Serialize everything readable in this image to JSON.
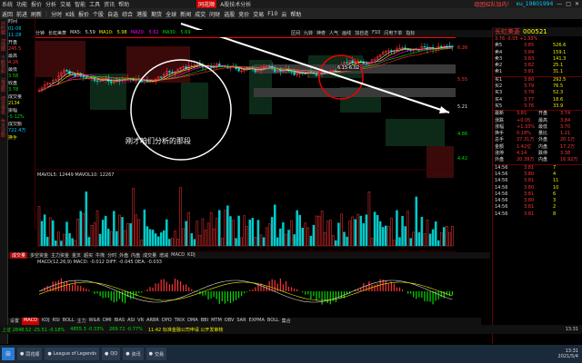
{
  "titlebar": {
    "menus": [
      "系统",
      "功能",
      "报价",
      "分析",
      "交易",
      "智能",
      "工具",
      "资讯",
      "帮助"
    ],
    "logo": "同花顺",
    "mode": "A股技术分析",
    "promo": "组团招队加内！",
    "user": "xu_19801994"
  },
  "toolbar": {
    "items": [
      "返回",
      "前进",
      "刷新",
      "分时",
      "K线",
      "报价",
      "个股",
      "自选",
      "综合",
      "港股",
      "期货",
      "全球",
      "新闻",
      "成交",
      "问财",
      "选股",
      "竞价",
      "交易",
      "F10",
      "云",
      "帮助"
    ]
  },
  "leftstrip": [
    "分时图",
    "K线图",
    "个股资料",
    "自选股",
    "综合排名",
    "牛叉诊股"
  ],
  "infopanel": [
    "时间",
    "01-06",
    "11:28",
    "开盘",
    "245.5",
    "最高",
    "4.26",
    "最低",
    "3.58",
    "收盘",
    "3.78",
    "成交量",
    "2134",
    "振幅",
    "-5.12%",
    "成交额",
    "722.4万",
    "换手",
    "1.00"
  ],
  "chartbar": [
    "分钟",
    "长虹美菱",
    "MA5:",
    "5.59",
    "MA10:",
    "5.98",
    "MA20:",
    "5.62",
    "MA30:",
    "5.69"
  ],
  "charttoolbar": [
    "区间",
    "九转",
    "神奇",
    "人气",
    "画线",
    "加自选",
    "F10",
    "闪电下单",
    "指标"
  ],
  "annotation": "刚才咱们分析的那段",
  "pricelabels": [
    "6.26",
    "5.55",
    "5.21",
    "4.86",
    "4.42"
  ],
  "callout": "6.15-6.02",
  "vol_label": "MAVOL5: 12449  MAVOL10: 12267",
  "macd_label": "MACD(12,26,9)  MACD: -0.012  DIFF: -0.045  DEA: -0.033",
  "indicator_tabs": [
    "成交量",
    "多空资金",
    "主力资金",
    "金叉",
    "超买",
    "牛熊",
    "分时",
    "外盘",
    "内盘",
    "成交量",
    "增减",
    "MACD",
    "KDJ"
  ],
  "bottomtabs": [
    "设置",
    "MACD",
    "KDJ",
    "RSI",
    "BOLL",
    "主力",
    "W&R",
    "DMI",
    "BIAS",
    "ASI",
    "VR",
    "ARBR",
    "DPO",
    "TRIX",
    "DMA",
    "BBI",
    "MTM",
    "OBV",
    "SAR",
    "EXPMA",
    "BOLL",
    "集合"
  ],
  "rp": {
    "title": "长虹美菱",
    "code": "000521",
    "price_line": "3.76   -0.05 +1.33%",
    "sells": [
      [
        "卖5",
        "3.85",
        "526.6"
      ],
      [
        "卖4",
        "3.84",
        "159.1"
      ],
      [
        "卖3",
        "3.83",
        "141.3"
      ],
      [
        "卖2",
        "3.82",
        "25.1"
      ],
      [
        "卖1",
        "3.81",
        "31.1"
      ]
    ],
    "buys": [
      [
        "买1",
        "3.80",
        "292.5"
      ],
      [
        "买2",
        "3.79",
        "76.5"
      ],
      [
        "买3",
        "3.78",
        "52.3"
      ],
      [
        "买4",
        "3.77",
        "18.6"
      ],
      [
        "买5",
        "3.76",
        "33.9"
      ]
    ],
    "stats": [
      [
        "最新",
        "3.81",
        "开盘",
        "3.74"
      ],
      [
        "涨跌",
        "+0.05",
        "最高",
        "3.84"
      ],
      [
        "涨幅",
        "+1.33%",
        "最低",
        "3.70"
      ],
      [
        "换手",
        "0.18%",
        "量比",
        "1.21"
      ],
      [
        "总手",
        "37.31万",
        "外盘",
        "20.1万"
      ],
      [
        "金额",
        "1.42亿",
        "内盘",
        "17.2万"
      ],
      [
        "涨停",
        "4.14",
        "跌停",
        "3.38"
      ],
      [
        "外盘",
        "20.39万",
        "内盘",
        "16.92万"
      ]
    ],
    "trades": [
      [
        "14:56",
        "3.81",
        "7"
      ],
      [
        "14:56",
        "3.80",
        "4"
      ],
      [
        "14:56",
        "3.81",
        "11"
      ],
      [
        "14:56",
        "3.80",
        "10"
      ],
      [
        "14:56",
        "3.81",
        "6"
      ],
      [
        "14:56",
        "3.80",
        "3"
      ],
      [
        "14:56",
        "3.81",
        "2"
      ],
      [
        "14:56",
        "3.81",
        "8"
      ]
    ]
  },
  "status": {
    "index1": "上证 2848.52  -25.51  -0.18%",
    "index2": "4855.3  -0.33%",
    "index3": "269.72  -0.77%",
    "marquee": "11:42 标准金融公司申请 公开发审核",
    "time": "13:31"
  },
  "taskbar": {
    "apps": [
      "同花顺",
      "League of Legends",
      "QQ",
      "资讯",
      "交易"
    ],
    "clock_time": "13:31",
    "clock_date": "2021/5/4"
  }
}
